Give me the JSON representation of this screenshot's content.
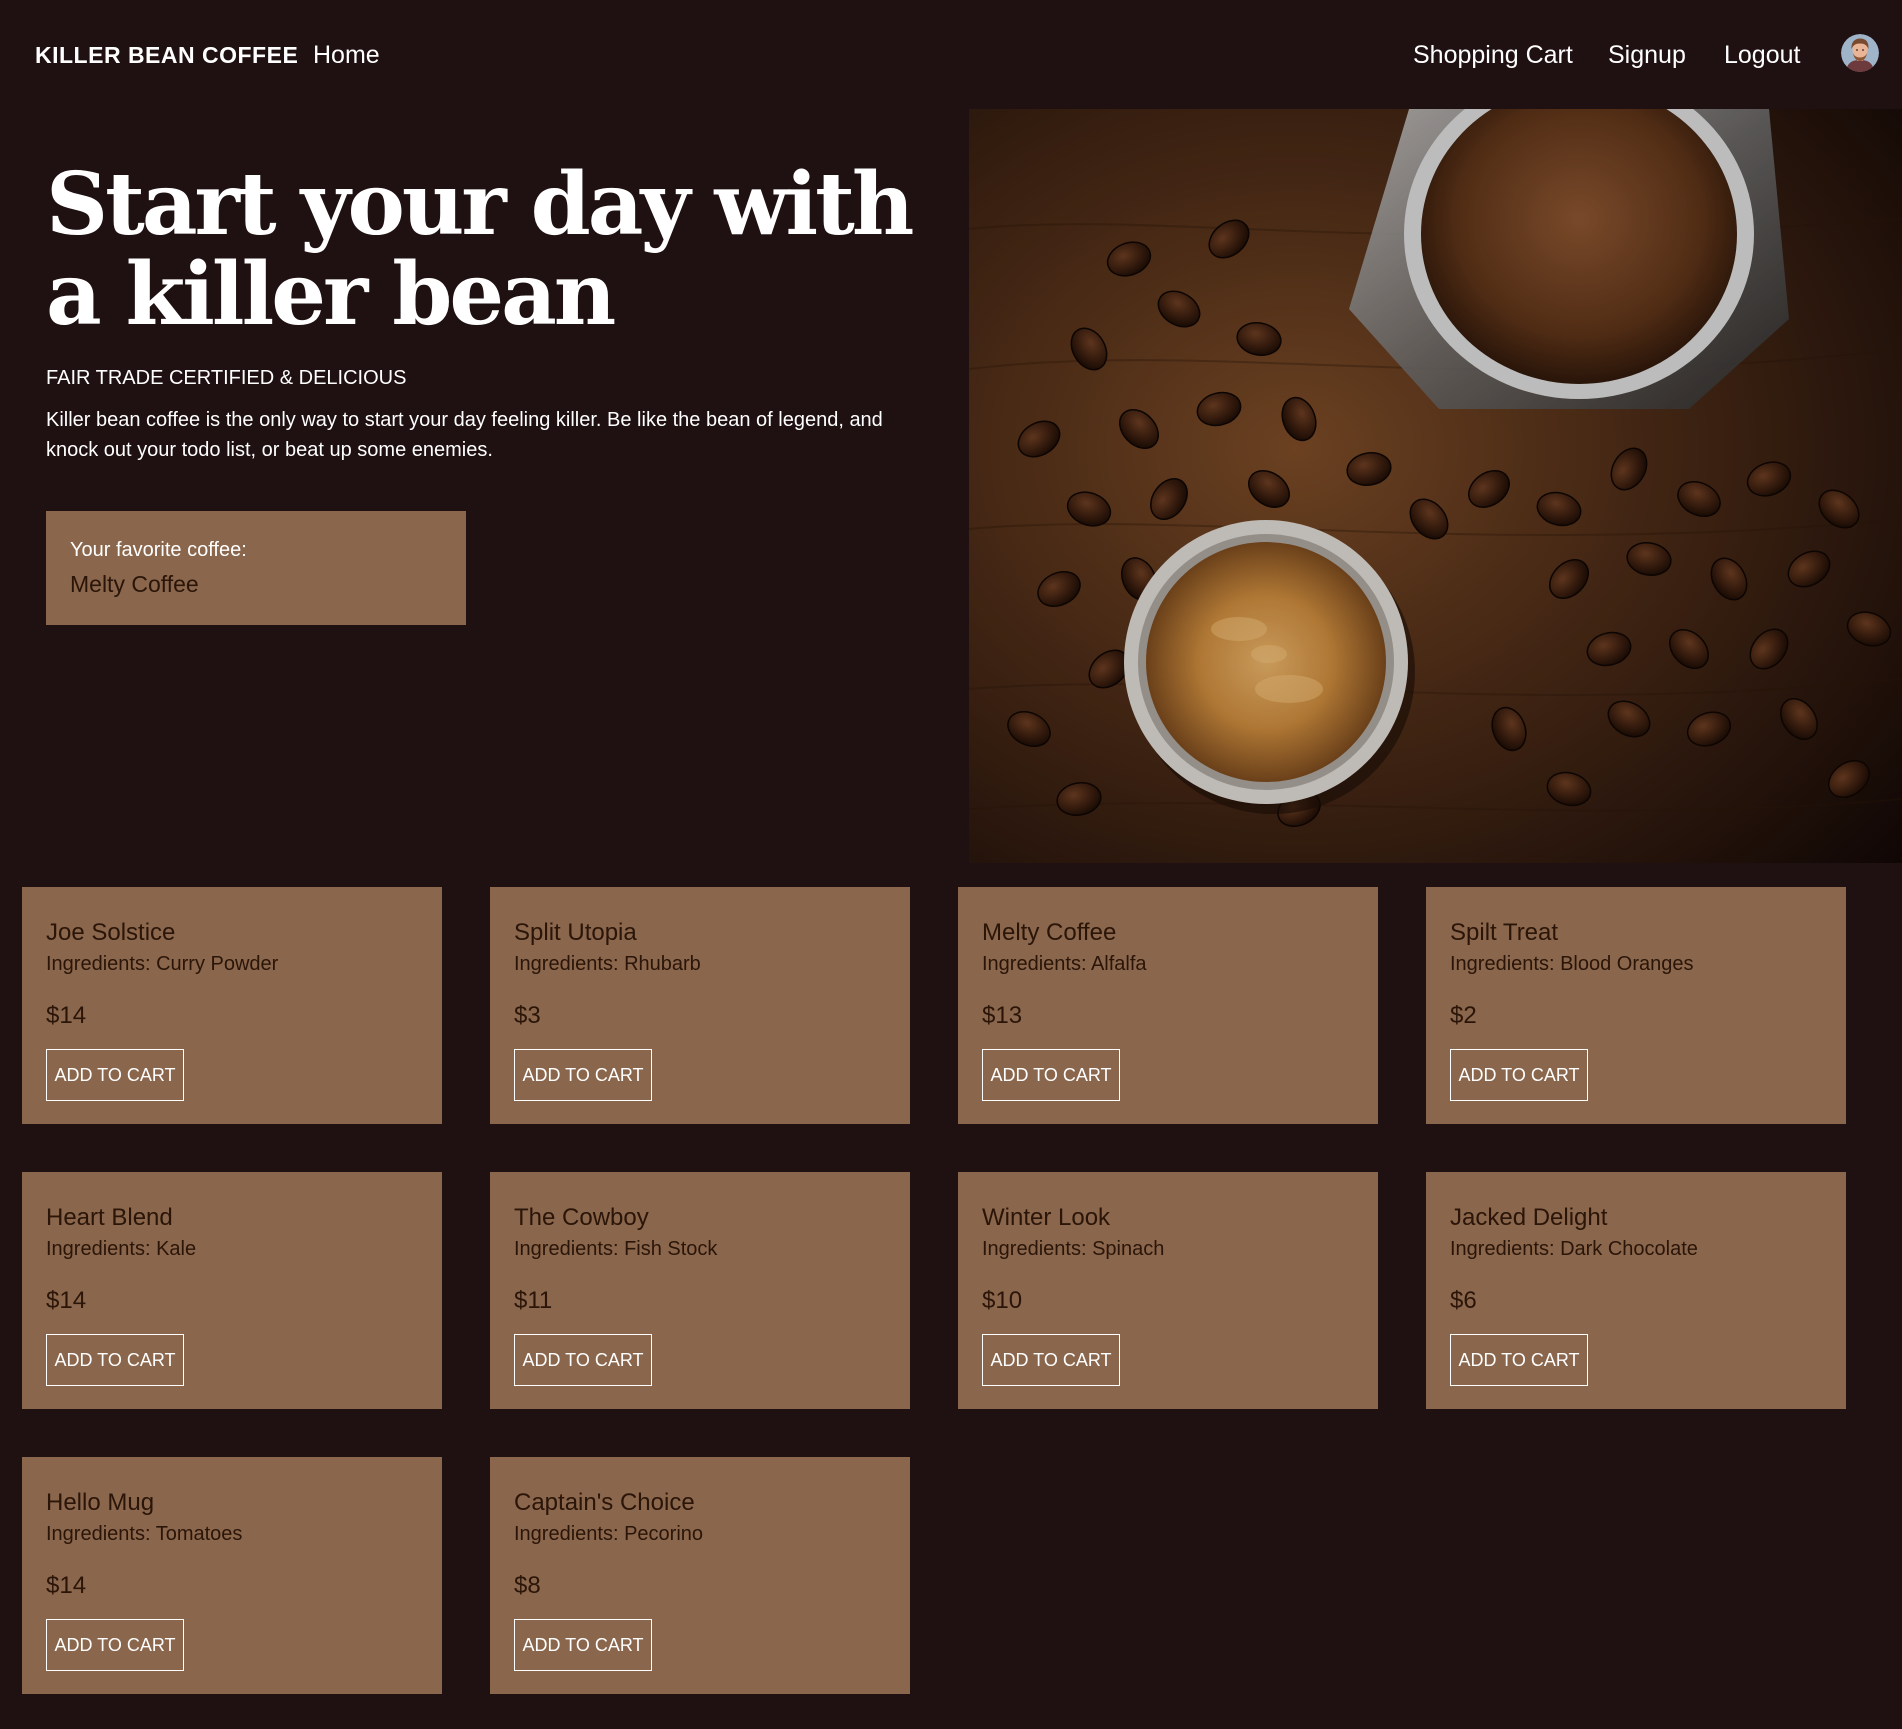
{
  "nav": {
    "brand": "KILLER BEAN COFFEE",
    "home": "Home",
    "cart": "Shopping Cart",
    "signup": "Signup",
    "logout": "Logout",
    "avatar_icon": "user-avatar-icon"
  },
  "hero": {
    "title": "Start your day with a killer bean",
    "tagline": "FAIR TRADE CERTIFIED & DELICIOUS",
    "description": "Killer bean coffee is the only way to start your day feeling killer. Be like the bean of legend, and knock out your todo list, or beat up some enemies.",
    "favorite_label": "Your favorite coffee:",
    "favorite_value": "Melty Coffee",
    "image": "coffee-beans-and-espresso-photo"
  },
  "colors": {
    "background": "#1f1011",
    "card": "#8a664c",
    "card_text": "#2a1508",
    "text": "#ffffff"
  },
  "products": [
    {
      "name": "Joe Solstice",
      "ingredients": "Ingredients: Curry Powder",
      "price": "$14",
      "button": "ADD TO CART"
    },
    {
      "name": "Split Utopia",
      "ingredients": "Ingredients: Rhubarb",
      "price": "$3",
      "button": "ADD TO CART"
    },
    {
      "name": "Melty Coffee",
      "ingredients": "Ingredients: Alfalfa",
      "price": "$13",
      "button": "ADD TO CART"
    },
    {
      "name": "Spilt Treat",
      "ingredients": "Ingredients: Blood Oranges",
      "price": "$2",
      "button": "ADD TO CART"
    },
    {
      "name": "Heart Blend",
      "ingredients": "Ingredients: Kale",
      "price": "$14",
      "button": "ADD TO CART"
    },
    {
      "name": "The Cowboy",
      "ingredients": "Ingredients: Fish Stock",
      "price": "$11",
      "button": "ADD TO CART"
    },
    {
      "name": "Winter Look",
      "ingredients": "Ingredients: Spinach",
      "price": "$10",
      "button": "ADD TO CART"
    },
    {
      "name": "Jacked Delight",
      "ingredients": "Ingredients: Dark Chocolate",
      "price": "$6",
      "button": "ADD TO CART"
    },
    {
      "name": "Hello Mug",
      "ingredients": "Ingredients: Tomatoes",
      "price": "$14",
      "button": "ADD TO CART"
    },
    {
      "name": "Captain's Choice",
      "ingredients": "Ingredients: Pecorino",
      "price": "$8",
      "button": "ADD TO CART"
    }
  ]
}
